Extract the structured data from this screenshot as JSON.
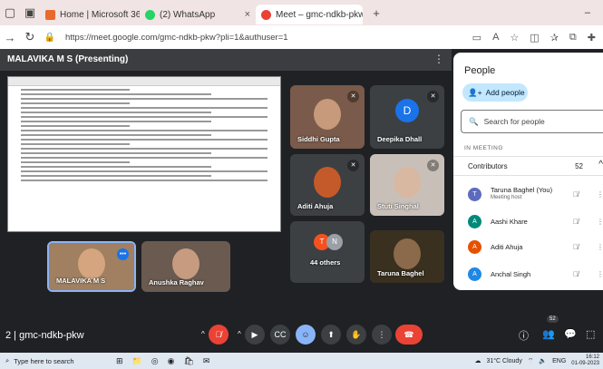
{
  "browser": {
    "tabs": [
      {
        "label": "Home | Microsoft 365",
        "color": "#e86a2b"
      },
      {
        "label": "(2) WhatsApp",
        "color": "#25d366"
      },
      {
        "label": "Meet – gmc-ndkb-pkw",
        "color": "#ea4335"
      }
    ],
    "url": "https://meet.google.com/gmc-ndkb-pkw?pli=1&authuser=1"
  },
  "meet": {
    "presenting_label": "MALAVIKA M S (Presenting)",
    "meeting_code": "gmc-ndkb-pkw",
    "tiles": [
      {
        "name": "Siddhi Gupta",
        "skin": "#c69a7a",
        "bg": "#7a5a4a"
      },
      {
        "name": "Deepika Dhall",
        "initial": "D",
        "avatar_color": "#1a73e8"
      },
      {
        "name": "Aditi Ahuja",
        "skin": "#c45a2a",
        "bg": "#3c4043"
      },
      {
        "name": "Stuti Singhal",
        "skin": "#d8b8a0",
        "bg": "#c8c0b8"
      },
      {
        "name": "44 others",
        "initials": [
          "T",
          "N"
        ]
      },
      {
        "name": "Taruna Baghel",
        "skin": "#8a6a4a",
        "bg": "#3a3020"
      },
      {
        "name": "MALAVIKA M S",
        "skin": "#d4a57f",
        "bg": "#a08060"
      },
      {
        "name": "Anushka Raghav",
        "skin": "#c79b80",
        "bg": "#6a5a50"
      }
    ],
    "reactions": [
      "💖",
      "👍",
      "🎉",
      "👏",
      "😂",
      "😮",
      "😢",
      "🤔",
      "👎"
    ],
    "participant_badge": "52"
  },
  "people_panel": {
    "title": "People",
    "add_label": "Add people",
    "search_placeholder": "Search for people",
    "in_meeting_label": "IN MEETING",
    "contributors_label": "Contributors",
    "contributors_count": "52",
    "people": [
      {
        "name": "Taruna Baghel (You)",
        "sub": "Meeting host",
        "initial": "T",
        "color": "#5c6bc0"
      },
      {
        "name": "Aashi Khare",
        "sub": "",
        "initial": "A",
        "color": "#00897b"
      },
      {
        "name": "Aditi Ahuja",
        "sub": "",
        "initial": "A",
        "color": "#e65100"
      },
      {
        "name": "Anchal Singh",
        "sub": "",
        "initial": "A",
        "color": "#1e88e5"
      }
    ]
  },
  "taskbar": {
    "search_placeholder": "Type here to search",
    "weather": "31°C Cloudy",
    "language": "ENG",
    "time": "16:12",
    "date": "01-09-2023"
  }
}
